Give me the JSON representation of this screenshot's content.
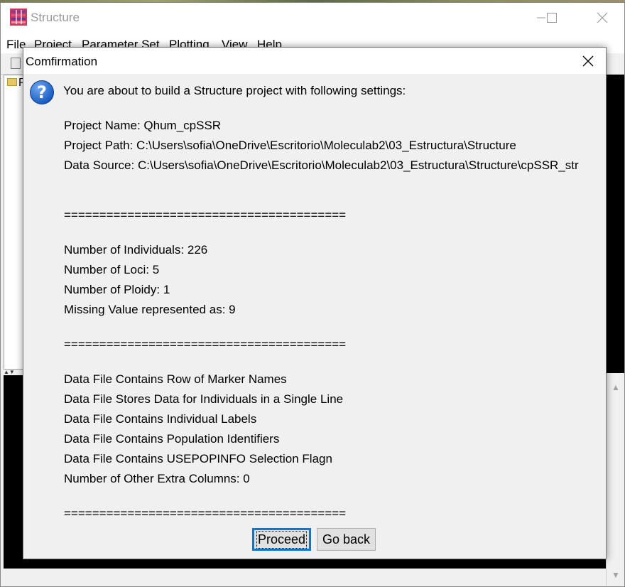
{
  "main_window": {
    "title": "Structure",
    "menu": [
      "File",
      "Project",
      "Parameter Set",
      "Plotting",
      "View",
      "Help"
    ],
    "tree_first_char": "P"
  },
  "dialog": {
    "title": "Comfirmation",
    "intro": "You are about to build a Structure project with following settings:",
    "project_name": "Project Name:  Qhum_cpSSR",
    "project_path": "Project Path:  C:\\Users\\sofia\\OneDrive\\Escritorio\\Moleculab2\\03_Estructura\\Structure",
    "data_source": "Data Source:  C:\\Users\\sofia\\OneDrive\\Escritorio\\Moleculab2\\03_Estructura\\Structure\\cpSSR_str",
    "separator": "========================================",
    "num_individuals": "Number of Individuals:  226",
    "num_loci": "Number of Loci:  5",
    "num_ploidy": "Number of Ploidy:  1",
    "missing_value": "Missing Value represented as:  9",
    "row_marker_names": "Data File Contains Row of Marker Names",
    "single_line": "Data File Stores Data for Individuals in a Single Line",
    "individual_labels": "Data File Contains Individual Labels",
    "population_identifiers": "Data File Contains Population Identifiers",
    "usepopinfo_flag": "Data File Contains USEPOPINFO Selection Flagn",
    "extra_columns": "Number of Other Extra Columns:  0",
    "proceed_label": "Proceed",
    "goback_label": "Go back"
  },
  "colors": {
    "accent": "#0078d7",
    "question_icon": "#1c5fc4"
  },
  "icons": {
    "app": "structure-app-icon",
    "question": "question-icon",
    "close": "close-icon",
    "minimize": "minimize-icon",
    "maximize": "maximize-icon",
    "folder": "folder-icon"
  }
}
